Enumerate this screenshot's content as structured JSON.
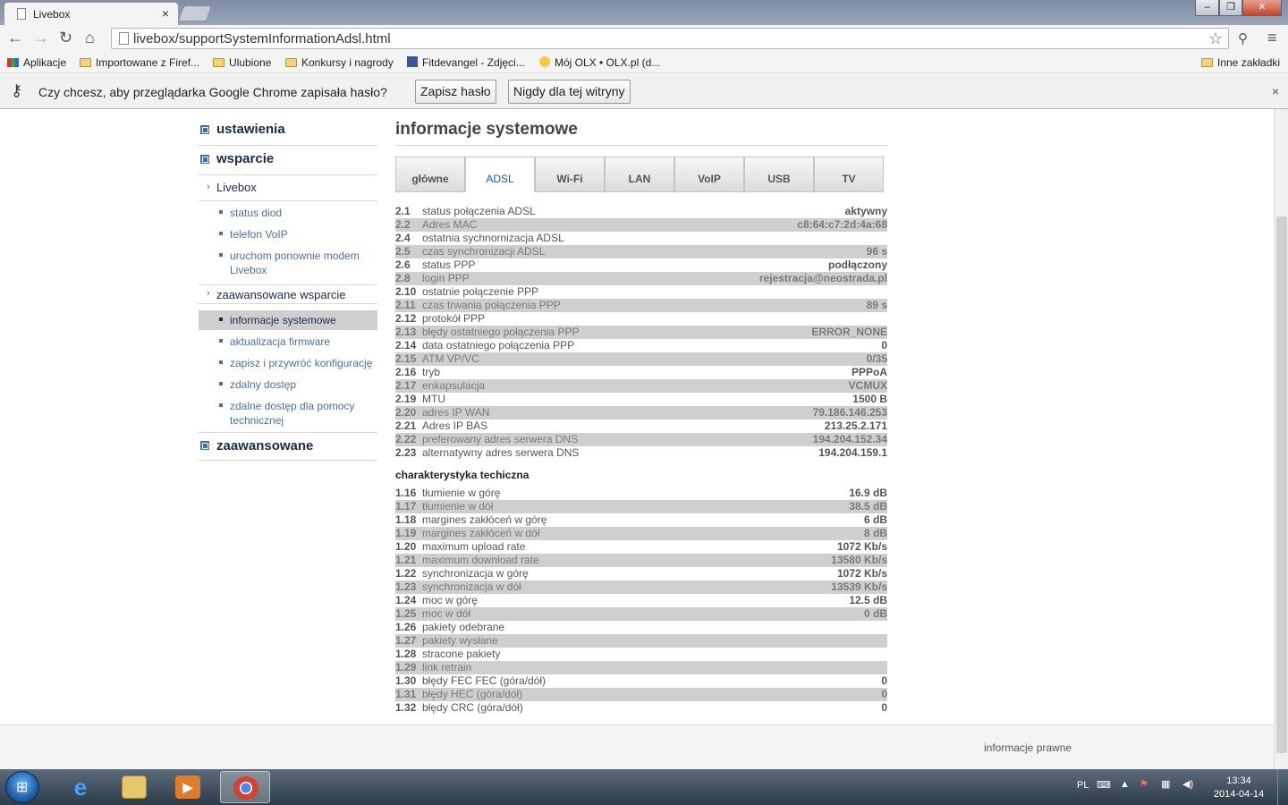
{
  "browser": {
    "tab_title": "Livebox",
    "tab_close": "×",
    "window_controls": [
      "–",
      "❐",
      "✕"
    ],
    "url": "livebox/supportSystemInformationAdsl.html",
    "bookmarks": [
      "Aplikacje",
      "Importowane z Firef...",
      "Ulubione",
      "Konkursy i nagrody",
      "Fitdevangel - Zdjęci...",
      "Mój OLX • OLX.pl (d...",
      "Inne zakładki"
    ],
    "infobar": {
      "message": "Czy chcesz, aby przeglądarka Google Chrome zapisała hasło?",
      "save_button": "Zapisz hasło",
      "never_button": "Nigdy dla tej witryny",
      "close": "×"
    }
  },
  "sidebar": {
    "sections": [
      "ustawienia",
      "wsparcie",
      "zaawansowane"
    ],
    "subsections": [
      "Livebox",
      "zaawansowane wsparcie"
    ],
    "livebox_links": [
      "status diod",
      "telefon VoIP",
      "uruchom ponownie modem Livebox"
    ],
    "advanced_links": [
      "informacje systemowe",
      "aktualizacja firmware",
      "zapisz i przywróć konfigurację",
      "zdalny dostęp",
      "zdalne dostęp dla pomocy technicznej"
    ]
  },
  "main": {
    "title": "informacje systemowe",
    "tabs": [
      "główne",
      "ADSL",
      "Wi-Fi",
      "LAN",
      "VoIP",
      "USB",
      "TV"
    ],
    "active_tab": "ADSL",
    "adsl_rows": [
      {
        "num": "2.1",
        "label": "status połączenia ADSL",
        "value": "aktywny"
      },
      {
        "num": "2.2",
        "label": "Adres MAC",
        "value": "c8:64:c7:2d:4a:68"
      },
      {
        "num": "2.4",
        "label": "ostatnia sychnornizacja ADSL",
        "value": ""
      },
      {
        "num": "2.5",
        "label": "czas synchronizacji ADSL",
        "value": "96 s"
      },
      {
        "num": "2.6",
        "label": "status PPP",
        "value": "podłączony"
      },
      {
        "num": "2.8",
        "label": "login PPP",
        "value": "rejestracja@neostrada.pl"
      },
      {
        "num": "2.10",
        "label": "ostatnie połączenie PPP",
        "value": ""
      },
      {
        "num": "2.11",
        "label": "czas trwania połączenia PPP",
        "value": "89 s"
      },
      {
        "num": "2.12",
        "label": "protokół PPP",
        "value": ""
      },
      {
        "num": "2.13",
        "label": "błędy ostatniego połączenia PPP",
        "value": "ERROR_NONE"
      },
      {
        "num": "2.14",
        "label": "data ostatniego połączenia PPP",
        "value": "0"
      },
      {
        "num": "2.15",
        "label": "ATM VP/VC",
        "value": "0/35"
      },
      {
        "num": "2.16",
        "label": "tryb",
        "value": "PPPoA"
      },
      {
        "num": "2.17",
        "label": "enkapsulacja",
        "value": "VCMUX"
      },
      {
        "num": "2.19",
        "label": "MTU",
        "value": "1500 B"
      },
      {
        "num": "2.20",
        "label": "adres IP WAN",
        "value": "79.186.146.253"
      },
      {
        "num": "2.21",
        "label": "Adres IP BAS",
        "value": "213.25.2.171"
      },
      {
        "num": "2.22",
        "label": "preferowany adres serwera DNS",
        "value": "194.204.152.34"
      },
      {
        "num": "2.23",
        "label": "alternatywny adres serwera DNS",
        "value": "194.204.159.1"
      }
    ],
    "tech_title": "charakterystyka techiczna",
    "tech_rows": [
      {
        "num": "1.16",
        "label": "tłumienie w górę",
        "value": "16.9 dB"
      },
      {
        "num": "1.17",
        "label": "tłumienie w dół",
        "value": "38.5 dB"
      },
      {
        "num": "1.18",
        "label": "margines zakłóceń w górę",
        "value": "6 dB"
      },
      {
        "num": "1.19",
        "label": "margines zakłóceń w dół",
        "value": "8 dB"
      },
      {
        "num": "1.20",
        "label": "maximum upload rate",
        "value": "1072 Kb/s"
      },
      {
        "num": "1.21",
        "label": "maximum download rate",
        "value": "13580 Kb/s"
      },
      {
        "num": "1.22",
        "label": "synchronizacja w górę",
        "value": "1072 Kb/s"
      },
      {
        "num": "1.23",
        "label": "synchronizacja w dół",
        "value": "13539 Kb/s"
      },
      {
        "num": "1.24",
        "label": "moc w górę",
        "value": "12.5 dB"
      },
      {
        "num": "1.25",
        "label": "moc w dół",
        "value": "0 dB"
      },
      {
        "num": "1.26",
        "label": "pakiety odebrane",
        "value": ""
      },
      {
        "num": "1.27",
        "label": "pakiety wysłane",
        "value": ""
      },
      {
        "num": "1.28",
        "label": "stracone pakiety",
        "value": ""
      },
      {
        "num": "1.29",
        "label": "link retrain",
        "value": ""
      },
      {
        "num": "1.30",
        "label": "błędy FEC FEC (góra/dół)",
        "value": "0"
      },
      {
        "num": "1.31",
        "label": "błędy HEC (góra/dół)",
        "value": "0"
      },
      {
        "num": "1.32",
        "label": "błędy CRC (góra/dół)",
        "value": "0"
      }
    ]
  },
  "footer": {
    "legal": "informacje prawne"
  },
  "taskbar": {
    "language": "PL",
    "time": "13:34",
    "date": "2014-04-14"
  },
  "colors": {
    "accent": "#3c6fb6",
    "link": "#4b6fa8",
    "shade_row": "#cfcfcf",
    "active_tab_text": "#1a56a7"
  }
}
